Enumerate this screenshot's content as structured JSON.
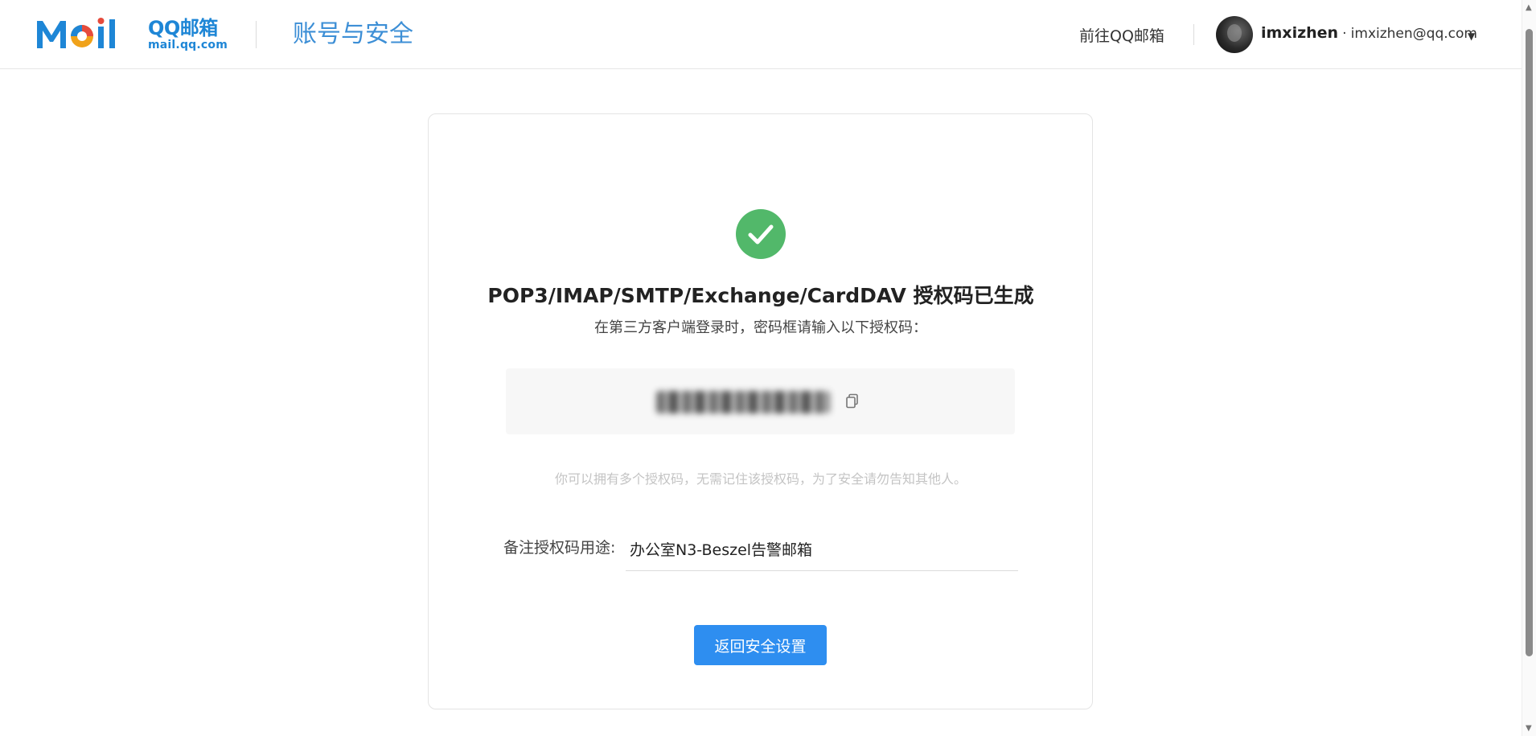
{
  "header": {
    "logo_title": "QQ邮箱",
    "logo_sub": "mail.qq.com",
    "section_title": "账号与安全",
    "goto_mail_label": "前往QQ邮箱",
    "user_name": "imxizhen",
    "user_sep": "·",
    "user_email": "imxizhen@qq.com"
  },
  "result": {
    "title": "POP3/IMAP/SMTP/Exchange/CardDAV 授权码已生成",
    "subtitle": "在第三方客户端登录时，密码框请输入以下授权码：",
    "hint": "你可以拥有多个授权码，无需记住该授权码，为了安全请勿告知其他人。",
    "note_label": "备注授权码用途:",
    "note_value": "办公室N3-Beszel告警邮箱",
    "back_button_label": "返回安全设置"
  },
  "icons": {
    "success": "check-circle-icon",
    "copy": "copy-icon",
    "caret": "caret-down-icon"
  },
  "colors": {
    "accent": "#2e8ef0",
    "success": "#52b86a",
    "brand_blue": "#1e86d6"
  }
}
